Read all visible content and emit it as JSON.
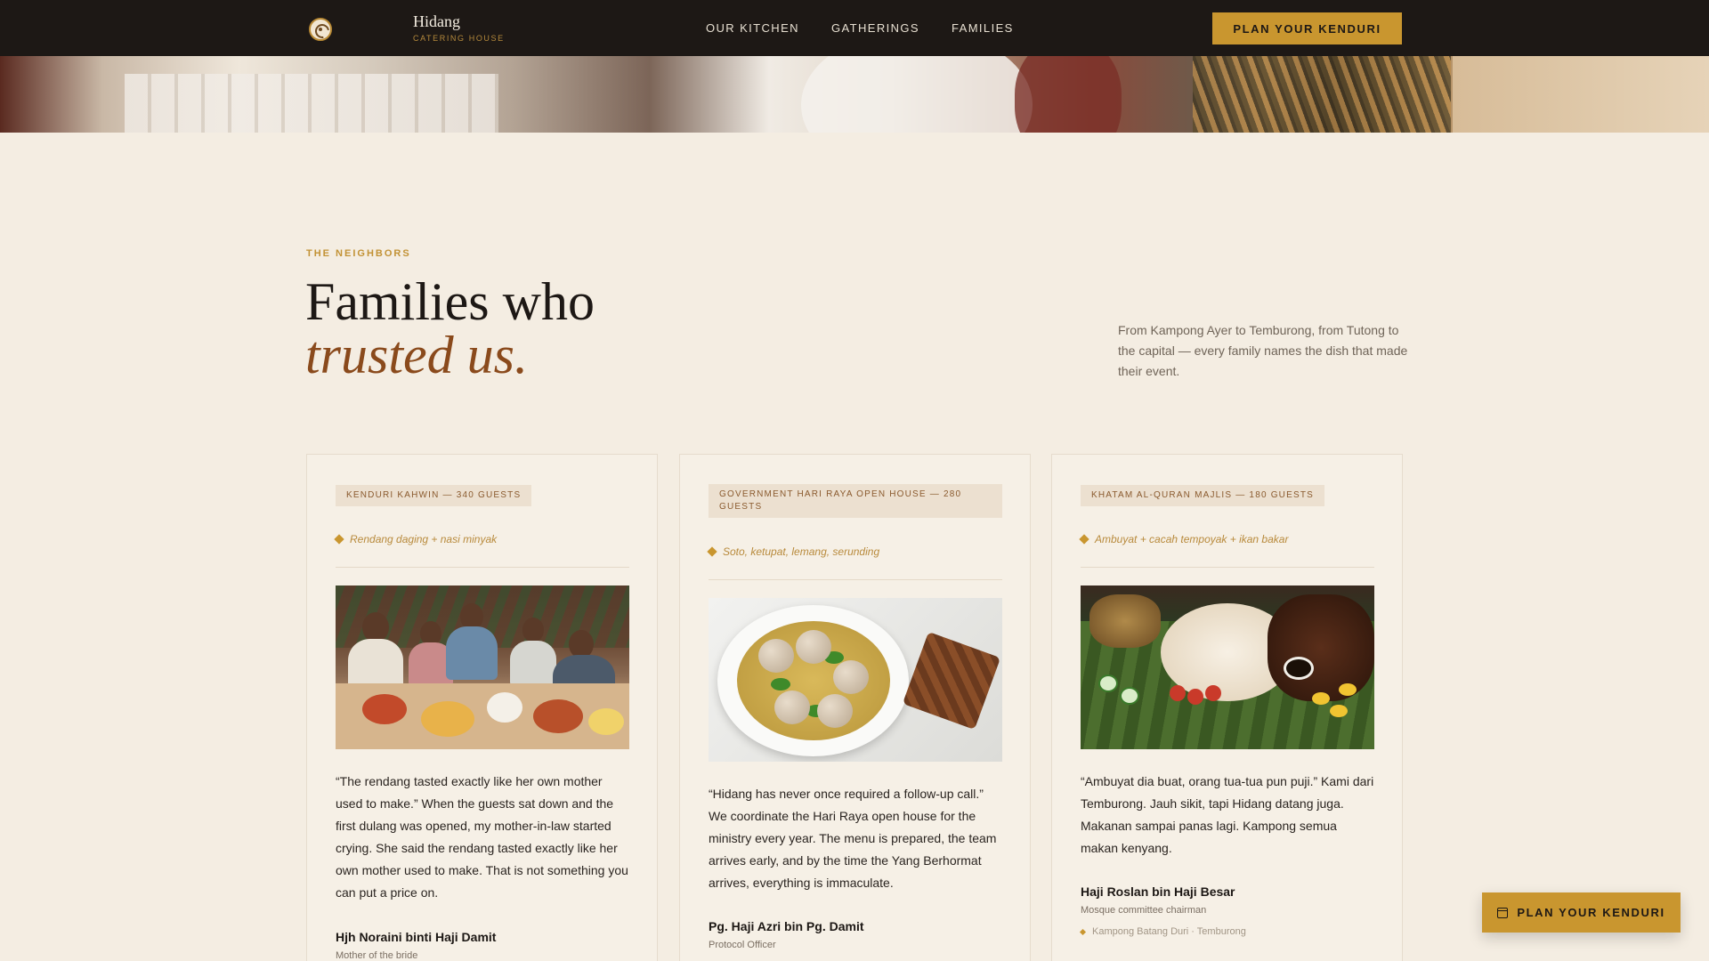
{
  "nav": {
    "brand_name": "Hidang",
    "brand_sub": "CATERING HOUSE",
    "links": [
      "OUR KITCHEN",
      "GATHERINGS",
      "FAMILIES"
    ],
    "cta_label": "PLAN YOUR KENDURI"
  },
  "section": {
    "eyebrow": "THE NEIGHBORS",
    "title_line1": "Families who",
    "title_line2": "trusted us.",
    "intro": "From Kampong Ayer to Temburong, from Tutong to the capital — every family names the dish that made their event."
  },
  "testimonials": [
    {
      "tag": "KENDURI KAHWIN — 340 GUESTS",
      "dish": "Rendang daging + nasi minyak",
      "quote": "“The rendang tasted exactly like her own mother used to make.” When the guests sat down and the first dulang was opened, my mother-in-law started crying. She said the rendang tasted exactly like her own mother used to make. That is not something you can put a price on.",
      "name": "Hjh Noraini binti Haji Damit",
      "role": "Mother of the bride"
    },
    {
      "tag": "GOVERNMENT HARI RAYA OPEN HOUSE — 280 GUESTS",
      "dish": "Soto, ketupat, lemang, serunding",
      "quote": "“Hidang has never once required a follow-up call.” We coordinate the Hari Raya open house for the ministry every year. The menu is prepared, the team arrives early, and by the time the Yang Berhormat arrives, everything is immaculate.",
      "name": "Pg. Haji Azri bin Pg. Damit",
      "role": "Protocol Officer"
    },
    {
      "tag": "KHATAM AL-QURAN MAJLIS — 180 GUESTS",
      "dish": "Ambuyat + cacah tempoyak + ikan bakar",
      "quote": "“Ambuyat dia buat, orang tua-tua pun puji.” Kami dari Temburong. Jauh sikit, tapi Hidang datang juga. Makanan sampai panas lagi. Kampong semua makan kenyang.",
      "name": "Haji Roslan bin Haji Besar",
      "role": "Mosque committee chairman",
      "location": "Kampong Batang Duri · Temburong"
    }
  ],
  "float_cta": {
    "label": "PLAN YOUR KENDURI",
    "icon": "calendar-icon"
  },
  "colors": {
    "accent": "#c9962f",
    "nav_bg": "#1d1815",
    "page_bg": "#f4ede2",
    "title_italic": "#8a4a1c"
  }
}
